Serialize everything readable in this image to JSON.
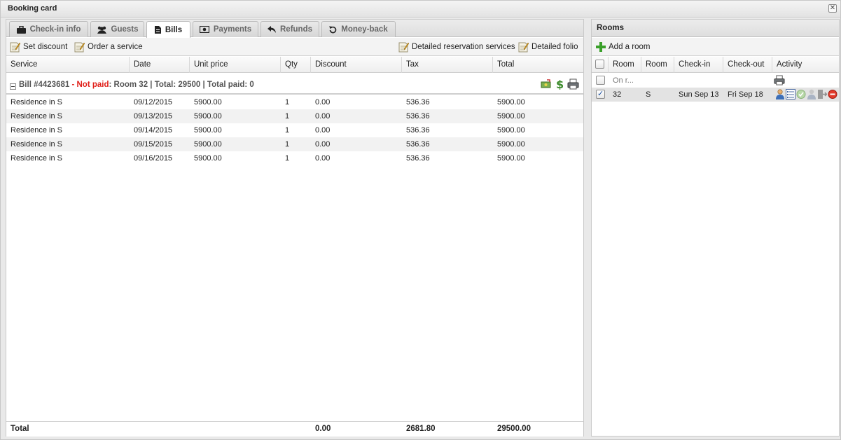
{
  "window": {
    "title": "Booking card"
  },
  "tabs": [
    {
      "label": "Check-in info",
      "icon": "briefcase-icon"
    },
    {
      "label": "Guests",
      "icon": "users-icon"
    },
    {
      "label": "Bills",
      "icon": "document-icon",
      "active": true
    },
    {
      "label": "Payments",
      "icon": "money-icon"
    },
    {
      "label": "Refunds",
      "icon": "reply-arrow-icon"
    },
    {
      "label": "Money-back",
      "icon": "undo-icon"
    }
  ],
  "toolbar": {
    "set_discount": "Set discount",
    "order_service": "Order a service",
    "detailed_services": "Detailed reservation services",
    "detailed_folio": "Detailed folio"
  },
  "grid": {
    "columns": [
      "Service",
      "Date",
      "Unit price",
      "Qty",
      "Discount",
      "Tax",
      "Total"
    ],
    "bill": {
      "number": "Bill #4423681",
      "separator": " - ",
      "status": "Not paid",
      "summary": ": Room 32 | Total: 29500 | Total paid: 0"
    },
    "rows": [
      [
        "Residence in S",
        "09/12/2015",
        "5900.00",
        "1",
        "0.00",
        "536.36",
        "5900.00"
      ],
      [
        "Residence in S",
        "09/13/2015",
        "5900.00",
        "1",
        "0.00",
        "536.36",
        "5900.00"
      ],
      [
        "Residence in S",
        "09/14/2015",
        "5900.00",
        "1",
        "0.00",
        "536.36",
        "5900.00"
      ],
      [
        "Residence in S",
        "09/15/2015",
        "5900.00",
        "1",
        "0.00",
        "536.36",
        "5900.00"
      ],
      [
        "Residence in S",
        "09/16/2015",
        "5900.00",
        "1",
        "0.00",
        "536.36",
        "5900.00"
      ]
    ],
    "footer": {
      "label": "Total",
      "discount": "0.00",
      "tax": "2681.80",
      "total": "29500.00"
    }
  },
  "rooms": {
    "title": "Rooms",
    "add_room": "Add a room",
    "columns": [
      "Room",
      "Room ty",
      "Check-in",
      "Check-out",
      "Activity"
    ],
    "filter_row": {
      "room": "On r..."
    },
    "rows": [
      {
        "checked": true,
        "room": "32",
        "type": "S",
        "check_in": "Sun Sep 13",
        "check_out": "Fri Sep 18"
      }
    ]
  },
  "colors": {
    "not_paid": "#e0201a",
    "add_green": "#3aa02a"
  }
}
